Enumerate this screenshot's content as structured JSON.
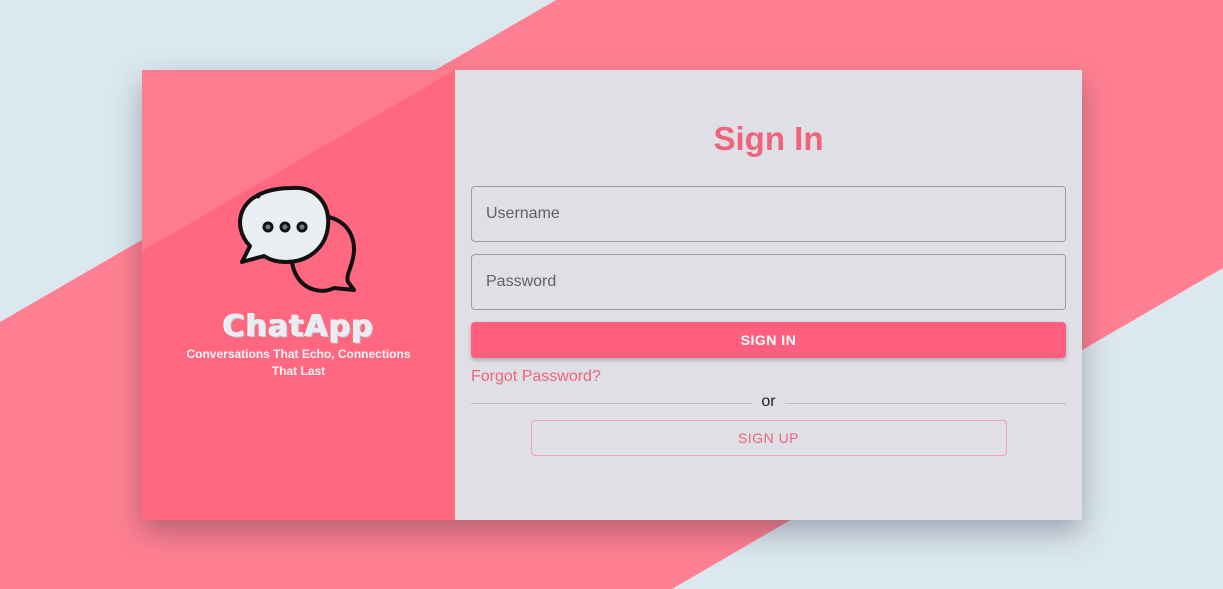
{
  "brand": {
    "app_name": "ChatApp",
    "tagline": "Conversations That Echo, Connections That Last",
    "logo_icon": "chat-bubbles-icon"
  },
  "form": {
    "title": "Sign In",
    "username": {
      "placeholder": "Username",
      "value": ""
    },
    "password": {
      "placeholder": "Password",
      "value": ""
    },
    "signin_label": "SIGN IN",
    "forgot_label": "Forgot Password?",
    "divider_text": "or",
    "signup_label": "SIGN UP"
  },
  "colors": {
    "background": "#dce8ef",
    "stripe": "#ff8092",
    "brand_panel": "#ff6880",
    "form_panel": "#dfe0e5",
    "accent": "#f0637b",
    "button": "#ff5f7c"
  }
}
